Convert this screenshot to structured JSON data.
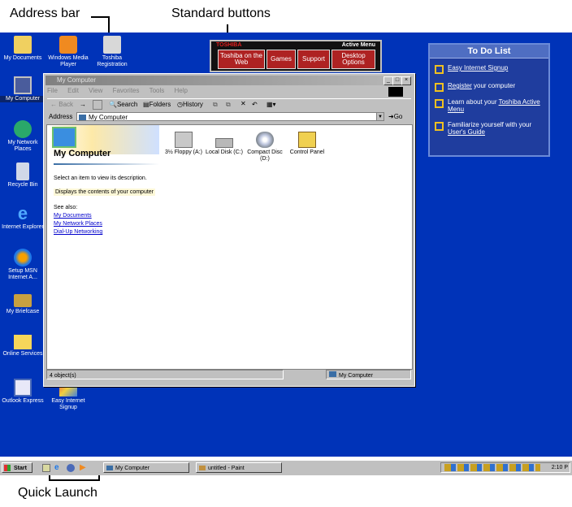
{
  "callouts": {
    "address_bar": "Address bar",
    "standard_buttons": "Standard buttons",
    "quick_launch": "Quick Launch"
  },
  "desktop": {
    "icons": [
      {
        "label": "My Documents",
        "icon": "folder-docs-icon"
      },
      {
        "label": "My Computer",
        "icon": "computer-icon",
        "selected": true
      },
      {
        "label": "My Network Places",
        "icon": "network-icon"
      },
      {
        "label": "Recycle Bin",
        "icon": "recycle-bin-icon"
      },
      {
        "label": "Internet Explorer",
        "icon": "ie-icon"
      },
      {
        "label": "Setup MSN Internet A...",
        "icon": "msn-icon"
      },
      {
        "label": "My Briefcase",
        "icon": "briefcase-icon"
      },
      {
        "label": "Online Services",
        "icon": "folder-icon"
      },
      {
        "label": "Outlook Express",
        "icon": "outlook-icon"
      },
      {
        "label": "Windows Media Player",
        "icon": "media-player-icon"
      },
      {
        "label": "Toshiba Registration",
        "icon": "registration-icon"
      },
      {
        "label": "Easy Internet Signup",
        "icon": "signup-icon"
      }
    ]
  },
  "active_menu": {
    "brand": "TOSHIBA",
    "title": "Active Menu",
    "buttons": [
      "Toshiba on the Web",
      "Games",
      "Support",
      "Desktop Options"
    ]
  },
  "todo": {
    "title": "To Do List",
    "item1": "Easy Internet Signup",
    "item2_link": "Register",
    "item2_rest": " your computer",
    "item3_a": "Learn about your ",
    "item3_link": "Toshiba Active Menu",
    "item4_a": "Familiarize yourself with your ",
    "item4_link": "User's Guide"
  },
  "window": {
    "title": "My Computer",
    "menu": [
      "File",
      "Edit",
      "View",
      "Favorites",
      "Tools",
      "Help"
    ],
    "toolbar": {
      "back": "Back",
      "search": "Search",
      "folders": "Folders",
      "history": "History"
    },
    "address_label": "Address",
    "address_value": "My Computer",
    "go_label": "Go",
    "heading": "My Computer",
    "hint": "Select an item to view its description.",
    "desc": "Displays the contents of your computer",
    "see_also": "See also:",
    "links": [
      "My Documents",
      "My Network Places",
      "Dial-Up Networking"
    ],
    "drives": [
      "3½ Floppy (A:)",
      "Local Disk (C:)",
      "Compact Disc (D:)",
      "Control Panel"
    ],
    "status_count": "4 object(s)",
    "status_zone": "My Computer"
  },
  "taskbar": {
    "start": "Start",
    "tasks": [
      "My Computer",
      "untitled - Paint"
    ],
    "clock": "2:10 P"
  },
  "colors": {
    "desktop": "#0033b8",
    "todo_bg": "#1f3d9e",
    "active_menu_btn": "#ae2222"
  }
}
